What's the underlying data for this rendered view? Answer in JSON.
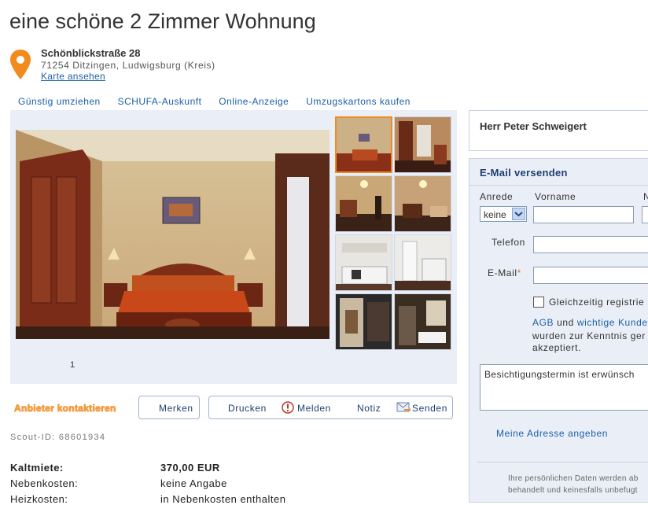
{
  "listing": {
    "title": "eine schöne 2 Zimmer Wohnung",
    "street": "Schönblickstraße 28",
    "city": "71254 Ditzingen, Ludwigsburg (Kreis)",
    "map_link": "Karte ansehen"
  },
  "top_nav": [
    "Günstig umziehen",
    "SCHUFA-Auskunft",
    "Online-Anzeige",
    "Umzugskartons kaufen"
  ],
  "gallery": {
    "page_number": "1"
  },
  "actions": {
    "contact": "Anbieter kontaktieren",
    "save": "Merken",
    "print": "Drucken",
    "report": "Melden",
    "note": "Notiz",
    "send": "Senden"
  },
  "scout_id": "Scout-ID: 68601934",
  "costs": [
    {
      "label": "Kaltmiete:",
      "value": "370,00 EUR"
    },
    {
      "label": "Nebenkosten:",
      "value": "keine Angabe"
    },
    {
      "label": "Heizkosten:",
      "value": "in Nebenkosten enthalten"
    }
  ],
  "contact_card": {
    "name": "Herr Peter Schweigert"
  },
  "email_form": {
    "heading": "E-Mail versenden",
    "anrede_label": "Anrede",
    "anrede_value": "keine",
    "vorname_label": "Vorname",
    "nachname_label_partial": "N",
    "telefon_label": "Telefon",
    "email_label": "E-Mail",
    "required_mark": "*",
    "checkbox_label": "Gleichzeitig registrie",
    "agb_link": "AGB",
    "and_text": "und",
    "policy_link": "wichtige Kunde",
    "agb_line2": "wurden zur Kenntnis ger",
    "agb_line3": "akzeptiert.",
    "message_text": "Besichtigungstermin ist erwünsch",
    "address_link": "Meine Adresse angeben",
    "privacy_line1": "Ihre persönlichen Daten werden ab",
    "privacy_line2": "behandelt und keinesfalls unbefugt"
  }
}
